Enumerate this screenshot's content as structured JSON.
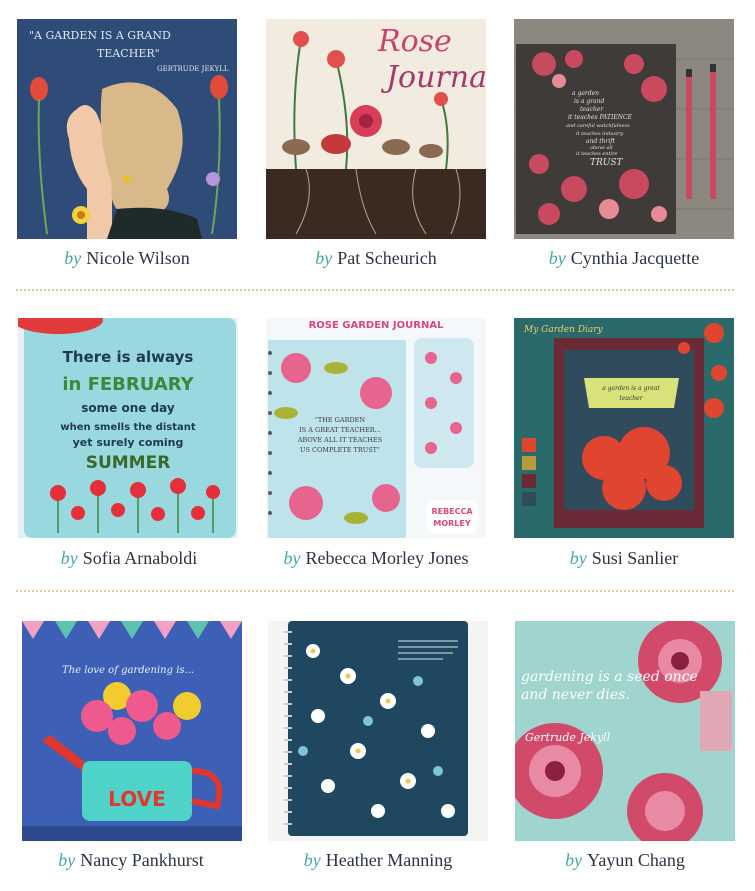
{
  "by_word": "by",
  "rows": [
    [
      {
        "name": "Nicole Wilson",
        "art_text": [
          "\"A GARDEN IS A GRAND",
          "TEACHER\"",
          "GERTRUDE JEKYLL"
        ]
      },
      {
        "name": "Pat Scheurich",
        "art_text": [
          "Rose",
          "Journal"
        ]
      },
      {
        "name": "Cynthia Jacquette",
        "art_text": [
          "a garden",
          "is a grand",
          "teacher",
          "it teaches PATIENCE",
          "and careful watchfulness",
          "it teaches industry",
          "and thrift",
          "above all",
          "it teaches entire",
          "TRUST"
        ]
      }
    ],
    [
      {
        "name": "Sofia Arnaboldi",
        "art_text": [
          "There is always",
          "in FEBRUARY",
          "some one day",
          "when smells the distant",
          "yet surely coming",
          "SUMMER"
        ]
      },
      {
        "name": "Rebecca Morley Jones",
        "art_text": [
          "ROSE GARDEN JOURNAL",
          "\"THE GARDEN",
          "IS A GREAT TEACHER...",
          "ABOVE ALL IT TEACHES",
          "US COMPLETE TRUST\"",
          "REBECCA",
          "MORLEY"
        ]
      },
      {
        "name": "Susi Sanlier",
        "art_text": [
          "My Garden Diary",
          "a garden is a great",
          "teacher"
        ]
      }
    ],
    [
      {
        "name": "Nancy Pankhurst",
        "art_text": [
          "The love of gardening is...",
          "LOVE"
        ]
      },
      {
        "name": "Heather Manning",
        "art_text": []
      },
      {
        "name": "Yayun Chang",
        "art_text": [
          "gardening is a seed once",
          "and never dies.",
          "Gertrude Jekyll"
        ]
      }
    ]
  ],
  "colors": {
    "name_text": "#2b3444",
    "by_text": "#4aa6a6",
    "separator": "#e9c9a0"
  }
}
